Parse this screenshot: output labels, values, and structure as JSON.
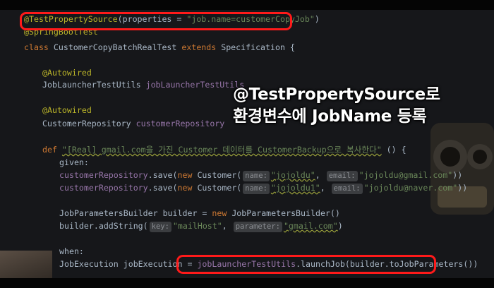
{
  "code": {
    "l1": {
      "annotation": "@TestPropertySource",
      "open": "(properties = ",
      "value": "\"job.name=customerCopyJob\"",
      "close": ")"
    },
    "l2": {
      "annotation": "@SpringBootTest"
    },
    "l3": {
      "kw_class": "class ",
      "name": "CustomerCopyBatchRealTest ",
      "kw_extends": "extends ",
      "parent": "Specification {"
    },
    "l4": {
      "annotation": "@Autowired"
    },
    "l5": {
      "type": "JobLauncherTestUtils ",
      "field": "jobLauncherTestUtils"
    },
    "l6": {
      "annotation": "@Autowired"
    },
    "l7": {
      "type": "CustomerRepository ",
      "field": "customerRepository"
    },
    "l8": {
      "kw_def": "def ",
      "name": "\"[Real] gmail.com을 가진 Customer 데이터를 CustomerBackup으로 복사한다\"",
      "tail": " () {"
    },
    "l9": {
      "label": "given:"
    },
    "l10": {
      "field": "customerRepository",
      "call": ".save(",
      "kw_new": "new ",
      "cls": "Customer(",
      "hint1": "name:",
      "arg1": "\"jojoldu\"",
      "comma": ", ",
      "hint2": "email:",
      "arg2": "\"jojoldu@gmail.com\"",
      "close": "))"
    },
    "l11": {
      "field": "customerRepository",
      "call": ".save(",
      "kw_new": "new ",
      "cls": "Customer(",
      "hint1": "name:",
      "arg1": "\"jojoldu1\"",
      "comma": ", ",
      "hint2": "email:",
      "arg2": "\"jojoldu@naver.com\"",
      "close": "))"
    },
    "l12": {
      "type": "JobParametersBuilder builder = ",
      "kw_new": "new ",
      "cls": "JobParametersBuilder()"
    },
    "l13": {
      "call": "builder.addString(",
      "hint1": "key:",
      "arg1": "\"mailHost\"",
      "comma": ", ",
      "hint2": "parameter:",
      "arg2": "\"gmail.com\"",
      "close": ")"
    },
    "l14": {
      "label": "when:"
    },
    "l15": {
      "decl": "JobExecution jobExecution = ",
      "field": "jobLauncherTestUtils",
      "call": ".launchJob(builder.toJobParameters())"
    }
  },
  "overlay": {
    "title": "@TestPropertySource로",
    "subtitle": "환경변수에 JobName 등록"
  },
  "colors": {
    "highlight_box": "#ff1a1a",
    "keyword": "#cc7832",
    "annotation": "#bbb529",
    "string": "#6a8759",
    "field": "#9876aa"
  }
}
